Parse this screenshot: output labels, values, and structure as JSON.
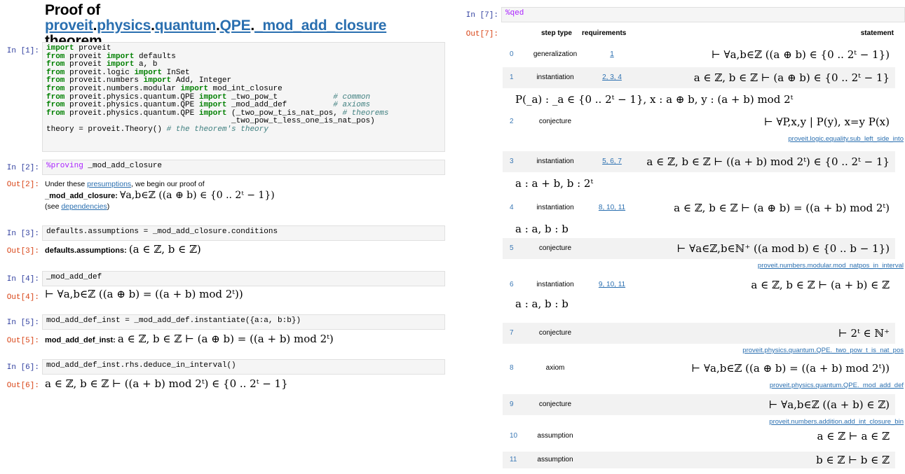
{
  "title": {
    "prefix": "Proof of ",
    "pkg": [
      "proveit",
      "physics",
      "quantum",
      "QPE",
      "_mod_add_closure"
    ],
    "suffix": "theorem"
  },
  "cells": {
    "in1": {
      "prompt": "In [1]:",
      "lines": [
        "import proveit",
        "from proveit import defaults",
        "from proveit import a, b",
        "from proveit.logic import InSet",
        "from proveit.numbers import Add, Integer",
        "from proveit.numbers.modular import mod_int_closure",
        "from proveit.physics.quantum.QPE import _two_pow_t            # common",
        "from proveit.physics.quantum.QPE import _mod_add_def          # axioms",
        "from proveit.physics.quantum.QPE import (_two_pow_t_is_nat_pos, # theorems",
        "                                        _two_pow_t_less_one_is_nat_pos)",
        "theory = proveit.Theory() # the theorem's theory"
      ]
    },
    "in2": {
      "prompt": "In [2]:",
      "magic": "%proving",
      "code": " _mod_add_closure"
    },
    "out2": {
      "prompt": "Out[2]:",
      "line1_pre": "Under these ",
      "line1_link": "presumptions",
      "line1_post": ", we begin our proof of",
      "name": "_mod_add_closure:",
      "stmt": "∀a,b∈ℤ ((a ⊕ b) ∈ {0 .. 2ᵗ − 1})",
      "see_pre": "(see ",
      "see_link": "dependencies",
      "see_post": ")"
    },
    "in3": {
      "prompt": "In [3]:",
      "code": "defaults.assumptions = _mod_add_closure.conditions"
    },
    "out3": {
      "prompt": "Out[3]:",
      "name": "defaults.assumptions:",
      "stmt": "(a ∈ ℤ, b ∈ ℤ)"
    },
    "in4": {
      "prompt": "In [4]:",
      "code": "_mod_add_def"
    },
    "out4": {
      "prompt": "Out[4]:",
      "stmt": "⊢ ∀a,b∈ℤ ((a ⊕ b) = ((a + b) mod 2ᵗ))"
    },
    "in5": {
      "prompt": "In [5]:",
      "code": "mod_add_def_inst = _mod_add_def.instantiate({a:a, b:b})"
    },
    "out5": {
      "prompt": "Out[5]:",
      "name": "mod_add_def_inst:",
      "stmt": "a ∈ ℤ, b ∈ ℤ ⊢ (a ⊕ b) = ((a + b) mod 2ᵗ)"
    },
    "in6": {
      "prompt": "In [6]:",
      "code": "mod_add_def_inst.rhs.deduce_in_interval()"
    },
    "out6": {
      "prompt": "Out[6]:",
      "stmt": "a ∈ ℤ, b ∈ ℤ ⊢ ((a + b) mod 2ᵗ) ∈ {0 .. 2ᵗ − 1}"
    },
    "in7": {
      "prompt": "In [7]:",
      "magic": "%qed"
    },
    "out7": {
      "prompt": "Out[7]:"
    }
  },
  "proof": {
    "headers": {
      "step": "step type",
      "req": "requirements",
      "stmt": "statement"
    },
    "rows": [
      {
        "num": "0",
        "type": "generalization",
        "reqs": "1",
        "stmt": "⊢ ∀a,b∈ℤ ((a ⊕ b) ∈ {0 .. 2ᵗ − 1})"
      },
      {
        "num": "1",
        "type": "instantiation",
        "reqs": "2, 3, 4",
        "stmt": "a ∈ ℤ, b ∈ ℤ ⊢ (a ⊕ b) ∈ {0 .. 2ᵗ − 1}"
      },
      {
        "inst": "P(_a) : _a ∈ {0 .. 2ᵗ − 1}, x : a ⊕ b, y : (a + b) mod 2ᵗ"
      },
      {
        "num": "2",
        "type": "conjecture",
        "reqs": "",
        "stmt": "⊢ ∀P,x,y | P(y), x=y P(x)",
        "ref": "proveit.logic.equality.sub_left_side_into"
      },
      {
        "num": "3",
        "type": "instantiation",
        "reqs": "5, 6, 7",
        "stmt": "a ∈ ℤ, b ∈ ℤ ⊢ ((a + b) mod 2ᵗ) ∈ {0 .. 2ᵗ − 1}"
      },
      {
        "inst": "a : a + b, b : 2ᵗ"
      },
      {
        "num": "4",
        "type": "instantiation",
        "reqs": "8, 10, 11",
        "stmt": "a ∈ ℤ, b ∈ ℤ ⊢ (a ⊕ b) = ((a + b) mod 2ᵗ)"
      },
      {
        "inst": "a : a, b : b"
      },
      {
        "num": "5",
        "type": "conjecture",
        "reqs": "",
        "stmt": "⊢ ∀a∈ℤ,b∈ℕ⁺ ((a mod b) ∈ {0 .. b − 1})",
        "ref": "proveit.numbers.modular.mod_natpos_in_interval"
      },
      {
        "num": "6",
        "type": "instantiation",
        "reqs": "9, 10, 11",
        "stmt": "a ∈ ℤ, b ∈ ℤ ⊢ (a + b) ∈ ℤ"
      },
      {
        "inst": "a : a, b : b"
      },
      {
        "num": "7",
        "type": "conjecture",
        "reqs": "",
        "stmt": "⊢ 2ᵗ ∈ ℕ⁺",
        "ref": "proveit.physics.quantum.QPE._two_pow_t_is_nat_pos"
      },
      {
        "num": "8",
        "type": "axiom",
        "reqs": "",
        "stmt": "⊢ ∀a,b∈ℤ ((a ⊕ b) = ((a + b) mod 2ᵗ))",
        "ref": "proveit.physics.quantum.QPE._mod_add_def"
      },
      {
        "num": "9",
        "type": "conjecture",
        "reqs": "",
        "stmt": "⊢ ∀a,b∈ℤ ((a + b) ∈ ℤ)",
        "ref": "proveit.numbers.addition.add_int_closure_bin"
      },
      {
        "num": "10",
        "type": "assumption",
        "reqs": "",
        "stmt": "a ∈ ℤ ⊢ a ∈ ℤ"
      },
      {
        "num": "11",
        "type": "assumption",
        "reqs": "",
        "stmt": "b ∈ ℤ ⊢ b ∈ ℤ"
      }
    ]
  }
}
